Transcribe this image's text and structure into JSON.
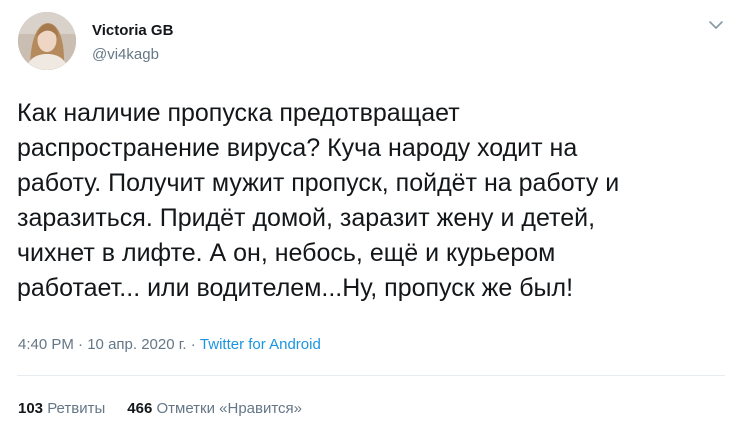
{
  "author": {
    "name": "Victoria GB",
    "handle": "@vi4kagb"
  },
  "tweet": {
    "lines": [
      "Как наличие пропуска предотвращает",
      "распространение вируса? Куча народу ходит на",
      "работу. Получит мужит пропуск, пойдёт на работу и",
      "заразиться. Придёт домой, заразит жену и детей,",
      "чихнет в лифте. А он, небось, ещё и курьером",
      "работает... или водителем...Ну, пропуск же был!"
    ]
  },
  "meta": {
    "time": "4:40 PM",
    "separator1": " · ",
    "date": "10 апр. 2020 г.",
    "separator2": " · ",
    "source": "Twitter for Android"
  },
  "stats": {
    "retweets_count": "103",
    "retweets_label": "Ретвиты",
    "likes_count": "466",
    "likes_label": "Отметки «Нравится»"
  },
  "icons": {
    "menu": "chevron-down-icon"
  },
  "colors": {
    "text": "#14171a",
    "secondary": "#657786",
    "link": "#1b95e0",
    "divider": "#e6ecf0"
  }
}
